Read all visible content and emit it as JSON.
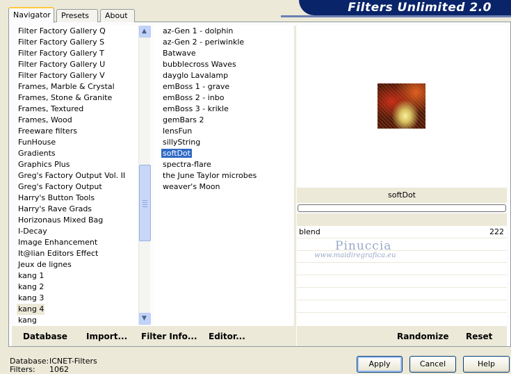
{
  "tabs": [
    {
      "label": "Navigator"
    },
    {
      "label": "Presets"
    },
    {
      "label": "About"
    }
  ],
  "brand": "Filters Unlimited 2.0",
  "categories": [
    "Filter Factory Gallery Q",
    "Filter Factory Gallery S",
    "Filter Factory Gallery T",
    "Filter Factory Gallery U",
    "Filter Factory Gallery V",
    "Frames, Marble & Crystal",
    "Frames, Stone & Granite",
    "Frames, Textured",
    "Frames, Wood",
    "Freeware filters",
    "FunHouse",
    "Gradients",
    "Graphics Plus",
    "Greg's Factory Output Vol. II",
    "Greg's Factory Output",
    "Harry's Button Tools",
    "Harry's Rave Grads",
    "Horizonaus Mixed Bag",
    "I-Decay",
    "Image Enhancement",
    "It@lian Editors Effect",
    "Jeux de lignes",
    "kang 1",
    "kang 2",
    "kang 3",
    "kang 4",
    "kang"
  ],
  "filters": [
    "az-Gen 1  -  dolphin",
    "az-Gen 2  -  periwinkle",
    "Batwave",
    "bubblecross Waves",
    "dayglo Lavalamp",
    "emBoss 1  -  grave",
    "emBoss 2  -  inbo",
    "emBoss 3  -  krikle",
    "gemBars 2",
    "lensFun",
    "sillyString",
    "softDot",
    "spectra-flare",
    "the June Taylor microbes",
    "weaver's Moon"
  ],
  "selected_filter": "softDot",
  "param": {
    "label": "blend",
    "value": "222"
  },
  "watermark": {
    "name": "Pinuccia",
    "url": "www.maidiregrafica.eu"
  },
  "toolbar": {
    "database": "Database",
    "import": "Import...",
    "filter_info": "Filter Info...",
    "editor": "Editor...",
    "randomize": "Randomize",
    "reset": "Reset"
  },
  "status": {
    "database_label": "Database:",
    "database_value": "ICNET-Filters",
    "filters_label": "Filters:",
    "filters_value": "1062"
  },
  "buttons": {
    "apply": "Apply",
    "cancel": "Cancel",
    "help": "Help"
  }
}
